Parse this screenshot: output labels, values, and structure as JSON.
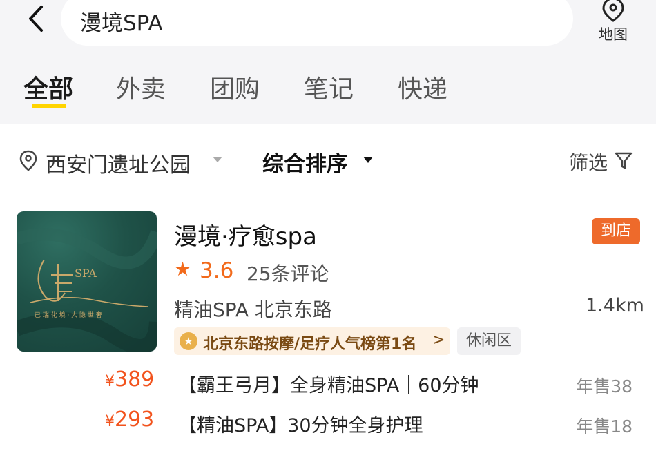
{
  "search": {
    "query": "漫境SPA",
    "map_label": "地图"
  },
  "tabs": [
    {
      "label": "全部",
      "active": true
    },
    {
      "label": "外卖",
      "active": false
    },
    {
      "label": "团购",
      "active": false
    },
    {
      "label": "笔记",
      "active": false
    },
    {
      "label": "快递",
      "active": false
    }
  ],
  "filters": {
    "location": "西安门遗址公园",
    "sort": "综合排序",
    "filter": "筛选"
  },
  "shop": {
    "name": "漫境·疗愈spa",
    "badge": "到店",
    "rating": "3.6",
    "reviews": "25条评论",
    "category": "精油SPA   北京东路",
    "distance": "1.4km",
    "rank": "北京东路按摩/足疗人气榜第1名",
    "rank_chevron": ">",
    "area_tag": "休闲区",
    "logo_text": "SPA",
    "logo_subtext": "已 瑞 化 境 · 大 隐 世 奢",
    "deals": [
      {
        "currency": "¥",
        "price": "389",
        "title": "【霸王弓月】全身精油SPA｜60分钟",
        "sales": "年售38"
      },
      {
        "currency": "¥",
        "price": "293",
        "title": "【精油SPA】30分钟全身护理",
        "sales": "年售18"
      }
    ]
  },
  "colors": {
    "accent_orange": "#f2531d",
    "badge_orange": "#ee6a2b",
    "tab_underline": "#ffd400"
  },
  "icons": {
    "back": "chevron-left-icon",
    "map": "map-pin-icon",
    "location": "location-pin-icon",
    "filter": "funnel-icon",
    "star": "star-icon",
    "medal": "medal-icon"
  }
}
